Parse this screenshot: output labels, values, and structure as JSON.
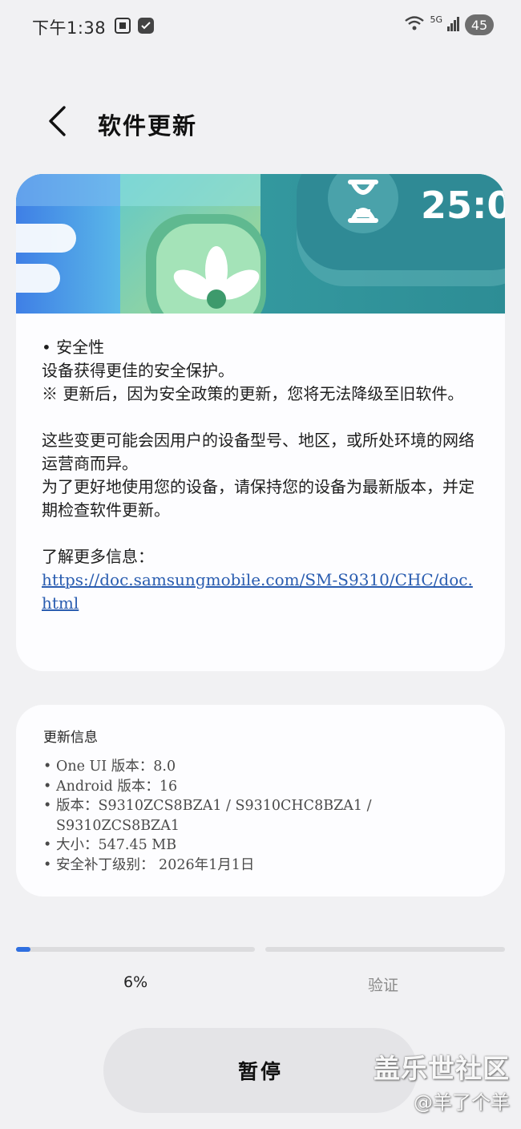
{
  "status_bar": {
    "time": "下午1:38",
    "network": "5G",
    "battery": "45",
    "icons": [
      "screenshot-icon",
      "check-shield-icon",
      "wifi-icon",
      "signal-icon",
      "battery-icon"
    ]
  },
  "header": {
    "title": "软件更新",
    "back_icon": "chevron-left-icon"
  },
  "banner": {
    "timer_text": "25:0"
  },
  "release_notes": {
    "line1": "• 安全性",
    "line2": "设备获得更佳的安全保护。",
    "line3": "※ 更新后，因为安全政策的更新，您将无法降级至旧软件。",
    "line4": "这些变更可能会因用户的设备型号、地区，或所处环境的网络运营商而异。",
    "line5": "为了更好地使用您的设备，请保持您的设备为最新版本，并定期检查软件更新。",
    "more_info_label": "了解更多信息：",
    "more_info_link": "https://doc.samsungmobile.com/SM-S9310/CHC/doc.html"
  },
  "update_info": {
    "title": "更新信息",
    "items": [
      "One UI 版本：8.0",
      "Android 版本：16",
      "版本：S9310ZCS8BZA1 / S9310CHC8BZA1 / S9310ZCS8BZA1",
      "大小：547.45 MB",
      "安全补丁级别： 2026年1月1日"
    ]
  },
  "progress": {
    "percent_label": "6%",
    "fraction": 0.06,
    "verify_label": "验证",
    "accent_color": "#2f6fe0"
  },
  "pause_button": {
    "label": "暂停"
  },
  "watermark": {
    "line1": "盖乐世社区",
    "line2": "@羊了个羊"
  }
}
